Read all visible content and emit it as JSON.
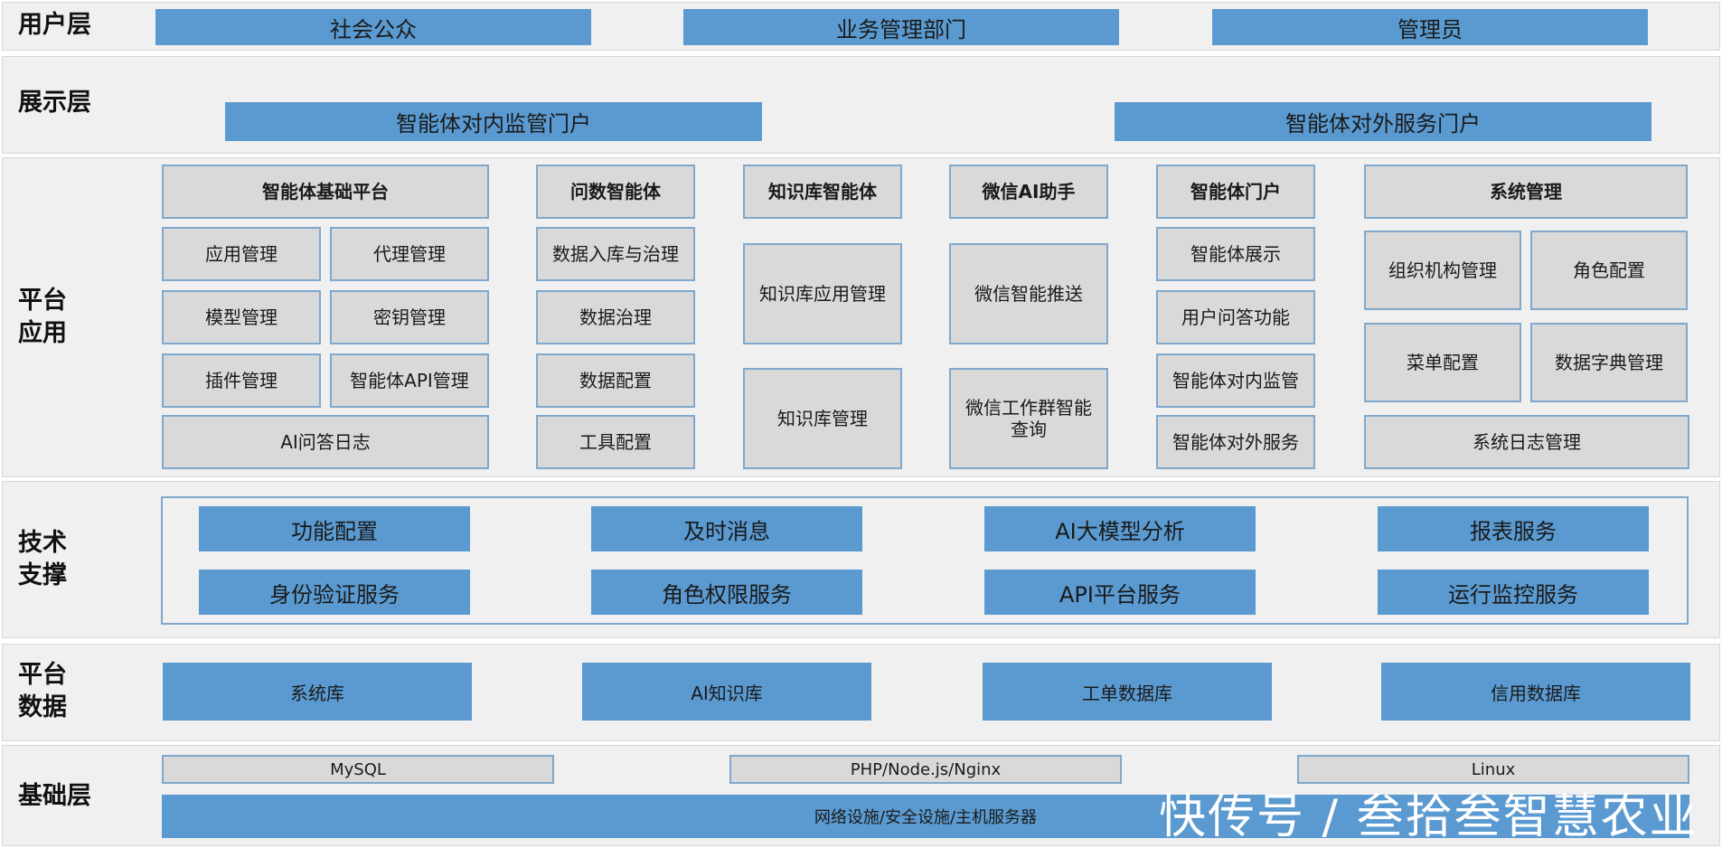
{
  "layers": {
    "user": {
      "label": "用户层",
      "items": [
        "社会公众",
        "业务管理部门",
        "管理员"
      ]
    },
    "display": {
      "label": "展示层",
      "items": [
        "智能体对内监管门户",
        "智能体对外服务门户"
      ]
    },
    "platform_app": {
      "label": "平台\n应用",
      "groups": [
        {
          "title": "智能体基础平台",
          "items": [
            "应用管理",
            "代理管理",
            "模型管理",
            "密钥管理",
            "插件管理",
            "智能体API管理",
            "AI问答日志"
          ]
        },
        {
          "title": "问数智能体",
          "items": [
            "数据入库与治理",
            "数据治理",
            "数据配置",
            "工具配置"
          ]
        },
        {
          "title": "知识库智能体",
          "items": [
            "知识库应用管理",
            "知识库管理"
          ]
        },
        {
          "title": "微信AI助手",
          "items": [
            "微信智能推送",
            "微信工作群智能\n查询"
          ]
        },
        {
          "title": "智能体门户",
          "items": [
            "智能体展示",
            "用户问答功能",
            "智能体对内监管",
            "智能体对外服务"
          ]
        },
        {
          "title": "系统管理",
          "items": [
            "组织机构管理",
            "角色配置",
            "菜单配置",
            "数据字典管理",
            "系统日志管理"
          ]
        }
      ]
    },
    "tech": {
      "label": "技术\n支撑",
      "items": [
        "功能配置",
        "及时消息",
        "AI大模型分析",
        "报表服务",
        "身份验证服务",
        "角色权限服务",
        "API平台服务",
        "运行监控服务"
      ]
    },
    "data": {
      "label": "平台\n数据",
      "items": [
        "系统库",
        "AI知识库",
        "工单数据库",
        "信用数据库"
      ]
    },
    "infra": {
      "label": "基础层",
      "items": [
        "MySQL",
        "PHP/Node.js/Nginx",
        "Linux"
      ],
      "base": "网络设施/安全设施/主机服务器"
    }
  },
  "watermark": "快传号 / 叁拾叁智慧农业",
  "colors": {
    "blue_box": "#5a9ad1",
    "gray_box": "#d9d9d9",
    "box_border": "#7fa8cc",
    "layer_bg": "#f0f0f0"
  }
}
